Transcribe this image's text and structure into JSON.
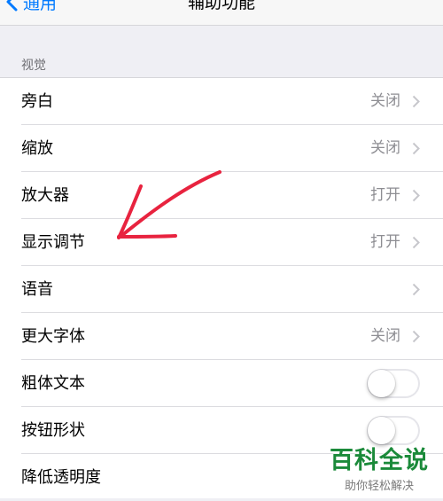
{
  "nav": {
    "back_label": "通用",
    "title": "辅助功能"
  },
  "section": {
    "header": "视觉"
  },
  "rows": [
    {
      "label": "旁白",
      "value": "关闭",
      "type": "chevron"
    },
    {
      "label": "缩放",
      "value": "关闭",
      "type": "chevron"
    },
    {
      "label": "放大器",
      "value": "打开",
      "type": "chevron"
    },
    {
      "label": "显示调节",
      "value": "打开",
      "type": "chevron"
    },
    {
      "label": "语音",
      "value": "",
      "type": "chevron"
    },
    {
      "label": "更大字体",
      "value": "关闭",
      "type": "chevron"
    },
    {
      "label": "粗体文本",
      "type": "toggle",
      "on": false
    },
    {
      "label": "按钮形状",
      "type": "toggle",
      "on": false
    },
    {
      "label": "降低透明度",
      "type": "chevron"
    }
  ],
  "colors": {
    "accent": "#007aff",
    "annotation": "#e8233f",
    "watermark": "#1b8a3a"
  },
  "watermark": {
    "title": "百科全说",
    "subtitle": "助你轻松解决"
  }
}
